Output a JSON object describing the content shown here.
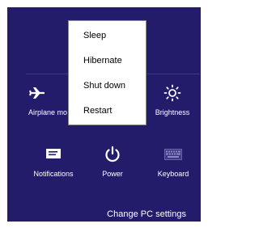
{
  "settings_pane": {
    "tiles": [
      {
        "label": "Airplane mo",
        "icon": "airplane-icon"
      },
      {
        "label": "Brightness",
        "icon": "brightness-icon"
      },
      {
        "label": "Notifications",
        "icon": "notifications-icon"
      },
      {
        "label": "Power",
        "icon": "power-icon"
      },
      {
        "label": "Keyboard",
        "icon": "keyboard-icon"
      }
    ],
    "change_pc_settings": "Change PC settings"
  },
  "power_menu": {
    "items": [
      "Sleep",
      "Hibernate",
      "Shut down",
      "Restart"
    ]
  },
  "colors": {
    "panel_bg": "#221c6a",
    "menu_bg": "#ffffff",
    "text_light": "#ffffff",
    "text_dark": "#000000"
  }
}
